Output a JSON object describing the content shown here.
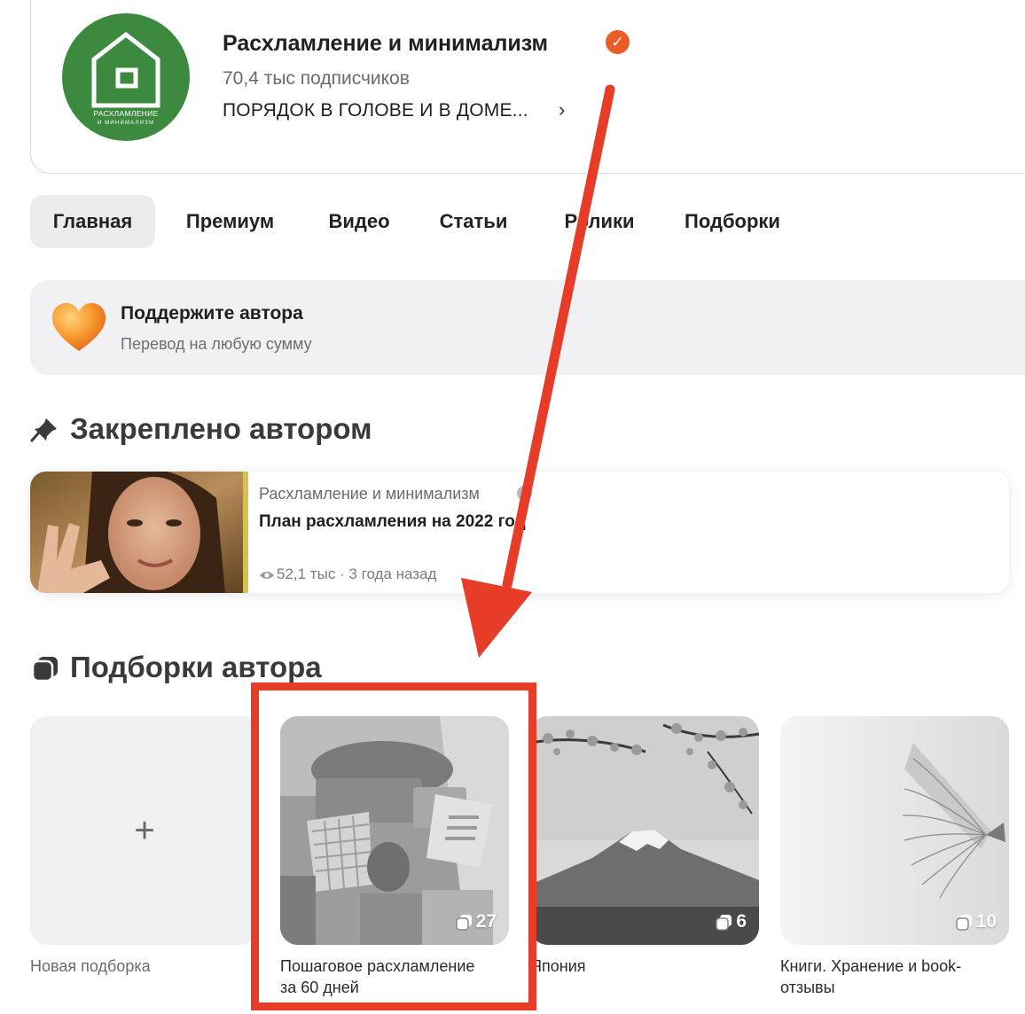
{
  "channel": {
    "logo_line1": "РАСХЛАМЛЕНИЕ",
    "logo_line2": "И МИНИМАЛИЗМ",
    "title": "Расхламление и минимализм",
    "verified_mark": "✓",
    "subscribers": "70,4 тыс подписчиков",
    "description": "ПОРЯДОК В ГОЛОВЕ И В ДОМЕ...",
    "description_chevron": "›"
  },
  "tabs": [
    {
      "label": "Главная",
      "active": true
    },
    {
      "label": "Премиум"
    },
    {
      "label": "Видео"
    },
    {
      "label": "Статьи"
    },
    {
      "label": "Ролики"
    },
    {
      "label": "Подборки"
    }
  ],
  "support": {
    "title": "Поддержите автора",
    "subtitle": "Перевод на любую сумму"
  },
  "pinned": {
    "section_title": "Закреплено автором",
    "source": "Расхламление и минимализм",
    "title": "План расхламления на 2022 год",
    "views": "52,1 тыс",
    "separator": "·",
    "age": "3 года назад"
  },
  "collections": {
    "section_title": "Подборки автора",
    "new_label": "Новая подборка",
    "plus": "+",
    "items": [
      {
        "label_line1": "Пошаговое расхламление",
        "label_line2": "за 60 дней",
        "count": "27"
      },
      {
        "label_line1": "Япония",
        "count": "6"
      },
      {
        "label_line1": "Книги. Хранение и book-",
        "label_line2": "отзывы",
        "count": "10"
      }
    ]
  },
  "colors": {
    "brand_green": "#3c8a3f",
    "verified_orange": "#ea5b26",
    "annotation_red": "#e63c28"
  },
  "icons": [
    "verified-icon",
    "heart-icon",
    "pin-icon",
    "collections-icon",
    "eye-icon",
    "stack-icon",
    "plus-icon"
  ]
}
